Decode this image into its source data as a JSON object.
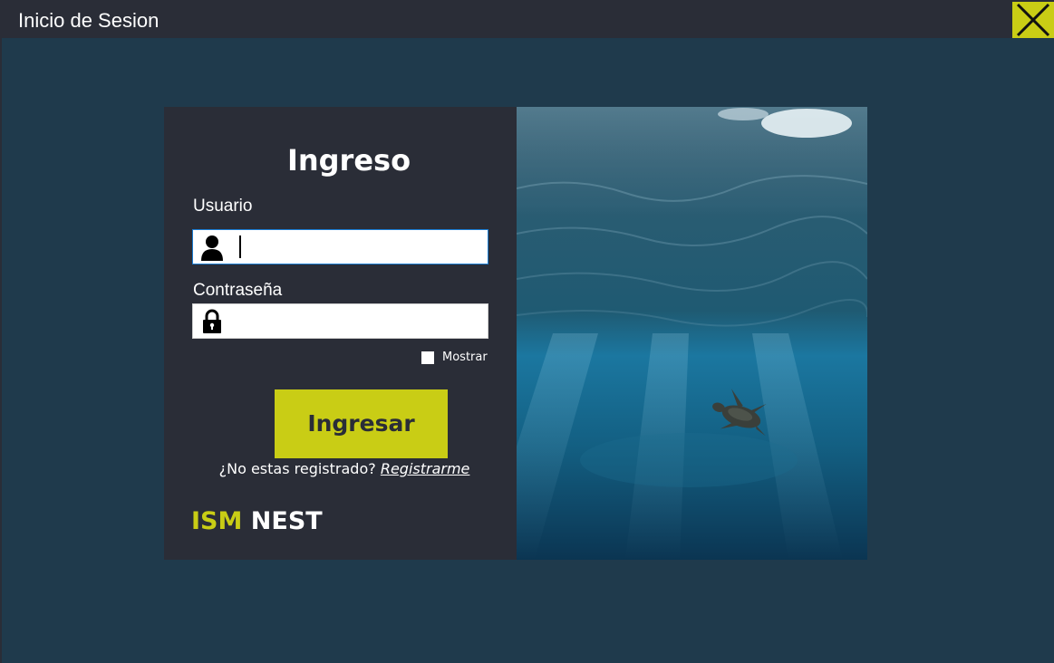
{
  "window": {
    "title": "Inicio de Sesion",
    "close_icon": "close-icon"
  },
  "login": {
    "heading": "Ingreso",
    "user_label": "Usuario",
    "user_value": "",
    "user_icon": "user-icon",
    "password_label": "Contraseña",
    "password_value": "",
    "password_icon": "lock-icon",
    "show_label": "Mostrar",
    "show_checked": false,
    "submit_label": "Ingresar",
    "register_prompt": "¿No estas registrado?",
    "register_link": "Registrarme"
  },
  "brand": {
    "part1": "ISM",
    "part2": "NEST"
  },
  "theme": {
    "accent": "#c9cd15",
    "panel": "#2a2d37",
    "background": "#1f3a4c"
  },
  "image": {
    "subject": "sea-turtle-underwater-photo"
  }
}
